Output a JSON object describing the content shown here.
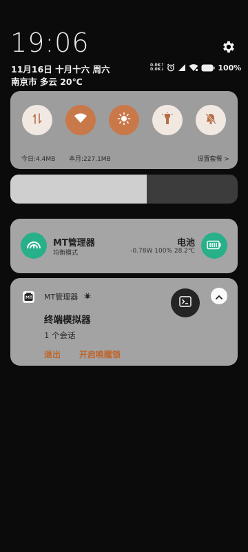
{
  "status": {
    "time": "19:06",
    "date": "11月16日 十月十六 周六",
    "weather": "南京市 多云 20℃",
    "net_up": "0.0K↑",
    "net_down": "0.0K↓",
    "battery": "100%"
  },
  "quick_settings": {
    "toggles": [
      {
        "name": "mobile-data",
        "icon": "data-arrows-icon",
        "state": "off"
      },
      {
        "name": "wifi",
        "icon": "wifi-icon",
        "state": "on"
      },
      {
        "name": "auto-brightness",
        "icon": "sun-icon",
        "state": "on"
      },
      {
        "name": "flashlight",
        "icon": "flashlight-icon",
        "state": "off"
      },
      {
        "name": "mute",
        "icon": "bell-off-icon",
        "state": "off"
      }
    ],
    "today_usage": "今日:4.4MB",
    "month_usage": "本月:227.1MB",
    "data_plan_link": "设置套餐 >"
  },
  "brightness": {
    "level": 0.6
  },
  "mt_card": {
    "app_title": "MT管理器",
    "app_subtitle": "均衡模式",
    "battery_title": "电池",
    "battery_detail": "-0.78W 100% 28.2℃"
  },
  "notification": {
    "app_name": "MT管理器",
    "title": "终端模拟器",
    "text": "1 个会话",
    "action_exit": "退出",
    "action_wakelock": "开启唤醒锁"
  },
  "colors": {
    "accent_orange": "#c9784a",
    "green": "#27b08a",
    "action_orange": "#c0652a"
  }
}
